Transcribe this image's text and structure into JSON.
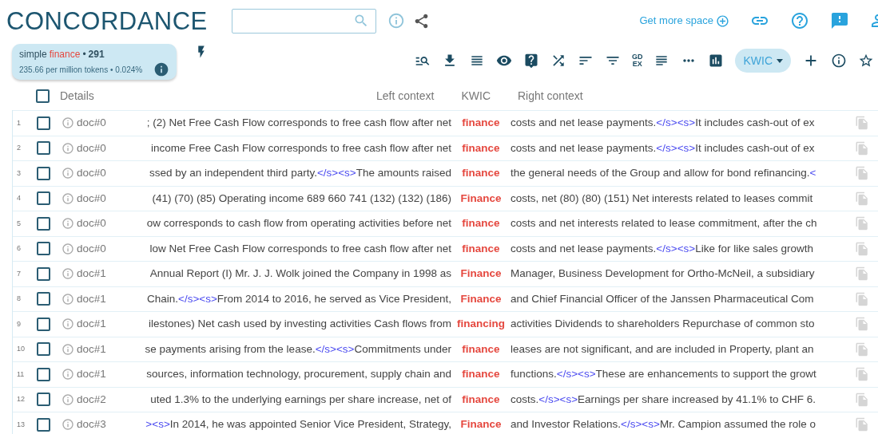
{
  "header": {
    "title": "CONCORDANCE",
    "get_more_space": "Get more space"
  },
  "summary": {
    "query": [
      {
        "kind": "plain",
        "text": "simple"
      },
      {
        "kind": "keyword",
        "text": "finance"
      },
      {
        "kind": "plain",
        "text": "•"
      },
      {
        "kind": "count",
        "text": "291"
      }
    ],
    "stats": "235.66 per million tokens • 0.024%"
  },
  "toolbar": {
    "gdex": [
      "GD",
      "EX"
    ],
    "view_mode": "KWIC"
  },
  "columns": {
    "details": "Details",
    "left": "Left context",
    "kwic": "KWIC",
    "right": "Right context",
    "select_all_checked": false
  },
  "rows": [
    {
      "num": "1",
      "checked": false,
      "doc": "doc#0",
      "left": [
        {
          "kind": "text",
          "text": "; (2) Net Free Cash Flow corresponds to free cash flow after net"
        }
      ],
      "kwic": "finance",
      "right": [
        {
          "kind": "text",
          "text": "costs and net lease payments."
        },
        {
          "kind": "tag",
          "text": "</s><s>"
        },
        {
          "kind": "text",
          "text": "It includes cash-out of ex"
        }
      ]
    },
    {
      "num": "2",
      "checked": false,
      "doc": "doc#0",
      "left": [
        {
          "kind": "text",
          "text": "income Free Cash Flow corresponds to free cash flow after net"
        }
      ],
      "kwic": "finance",
      "right": [
        {
          "kind": "text",
          "text": "costs and net lease payments."
        },
        {
          "kind": "tag",
          "text": "</s><s>"
        },
        {
          "kind": "text",
          "text": "It includes cash-out of ex"
        }
      ]
    },
    {
      "num": "3",
      "checked": false,
      "doc": "doc#0",
      "left": [
        {
          "kind": "text",
          "text": "ssed by an independent third party."
        },
        {
          "kind": "tag",
          "text": "</s><s>"
        },
        {
          "kind": "text",
          "text": "The amounts raised"
        }
      ],
      "kwic": "finance",
      "right": [
        {
          "kind": "text",
          "text": "the general needs of the Group and allow for bond refinancing."
        },
        {
          "kind": "tag",
          "text": "<"
        }
      ]
    },
    {
      "num": "4",
      "checked": false,
      "doc": "doc#0",
      "left": [
        {
          "kind": "text",
          "text": "(41) (70) (85) Operating income 689 660 741 (132) (132) (186)"
        }
      ],
      "kwic": "Finance",
      "right": [
        {
          "kind": "text",
          "text": "costs, net (80) (80) (151) Net interests related to leases commit"
        }
      ]
    },
    {
      "num": "5",
      "checked": false,
      "doc": "doc#0",
      "left": [
        {
          "kind": "text",
          "text": "ow corresponds to cash flow from operating activities before net"
        }
      ],
      "kwic": "finance",
      "right": [
        {
          "kind": "text",
          "text": "costs and net interests related to lease commitment, after the ch"
        }
      ]
    },
    {
      "num": "6",
      "checked": false,
      "doc": "doc#0",
      "left": [
        {
          "kind": "text",
          "text": "low Net Free Cash Flow corresponds to free cash flow after net"
        }
      ],
      "kwic": "finance",
      "right": [
        {
          "kind": "text",
          "text": "costs and net lease payments."
        },
        {
          "kind": "tag",
          "text": "</s><s>"
        },
        {
          "kind": "text",
          "text": "Like for like sales growth"
        }
      ]
    },
    {
      "num": "7",
      "checked": false,
      "doc": "doc#1",
      "left": [
        {
          "kind": "text",
          "text": "Annual Report (I) Mr. J. J. Wolk joined the Company in 1998 as"
        }
      ],
      "kwic": "Finance",
      "right": [
        {
          "kind": "text",
          "text": "Manager, Business Development for Ortho-McNeil, a subsidiary"
        }
      ]
    },
    {
      "num": "8",
      "checked": false,
      "doc": "doc#1",
      "left": [
        {
          "kind": "text",
          "text": "Chain."
        },
        {
          "kind": "tag",
          "text": "</s><s>"
        },
        {
          "kind": "text",
          "text": "From 2014 to 2016, he served as Vice President,"
        }
      ],
      "kwic": "Finance",
      "right": [
        {
          "kind": "text",
          "text": "and Chief Financial Officer of the Janssen Pharmaceutical Com"
        }
      ]
    },
    {
      "num": "9",
      "checked": false,
      "doc": "doc#1",
      "left": [
        {
          "kind": "text",
          "text": "ilestones) Net cash used by investing activities Cash flows from"
        }
      ],
      "kwic": "financing",
      "right": [
        {
          "kind": "text",
          "text": "activities Dividends to shareholders Repurchase of common sto"
        }
      ]
    },
    {
      "num": "10",
      "checked": false,
      "doc": "doc#1",
      "left": [
        {
          "kind": "text",
          "text": "se payments arising from the lease."
        },
        {
          "kind": "tag",
          "text": "</s><s>"
        },
        {
          "kind": "text",
          "text": "Commitments under"
        }
      ],
      "kwic": "finance",
      "right": [
        {
          "kind": "text",
          "text": "leases are not significant, and are included in Property, plant an"
        }
      ]
    },
    {
      "num": "11",
      "checked": false,
      "doc": "doc#1",
      "left": [
        {
          "kind": "text",
          "text": "sources, information technology, procurement, supply chain and"
        }
      ],
      "kwic": "finance",
      "right": [
        {
          "kind": "text",
          "text": "functions."
        },
        {
          "kind": "tag",
          "text": "</s><s>"
        },
        {
          "kind": "text",
          "text": "These are enhancements to support the growt"
        }
      ]
    },
    {
      "num": "12",
      "checked": false,
      "doc": "doc#2",
      "left": [
        {
          "kind": "text",
          "text": "uted 1.3% to the underlying earnings per share increase, net of"
        }
      ],
      "kwic": "finance",
      "right": [
        {
          "kind": "text",
          "text": "costs."
        },
        {
          "kind": "tag",
          "text": "</s><s>"
        },
        {
          "kind": "text",
          "text": "Earnings per share increased by 41.1% to CHF 6."
        }
      ]
    },
    {
      "num": "13",
      "checked": false,
      "doc": "doc#3",
      "left": [
        {
          "kind": "tag",
          "text": "><s>"
        },
        {
          "kind": "text",
          "text": "In 2014, he was appointed Senior Vice President, Strategy,"
        }
      ],
      "kwic": "Finance",
      "right": [
        {
          "kind": "text",
          "text": "and Investor Relations."
        },
        {
          "kind": "tag",
          "text": "</s><s>"
        },
        {
          "kind": "text",
          "text": "Mr. Campion assumed the role o"
        }
      ]
    }
  ]
}
